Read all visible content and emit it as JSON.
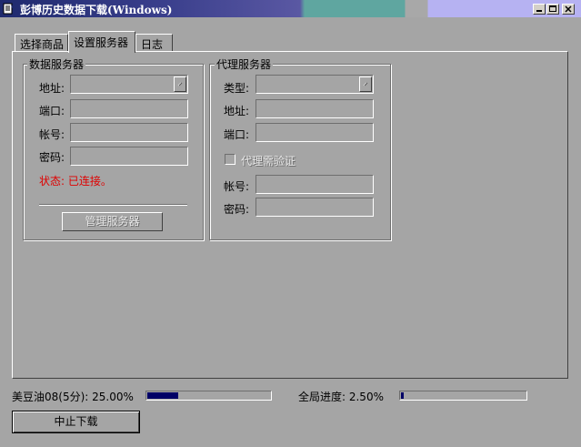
{
  "window": {
    "title": "彭博历史数据下载(Windows)"
  },
  "tabs": [
    {
      "label": "选择商品"
    },
    {
      "label": "设置服务器"
    },
    {
      "label": "日志"
    }
  ],
  "data_server": {
    "title": "数据服务器",
    "address_label": "地址:",
    "address_value": "",
    "port_label": "端口:",
    "port_value": "",
    "account_label": "帐号:",
    "account_value": "",
    "password_label": "密码:",
    "password_value": "",
    "status_text": "状态: 已连接。",
    "manage_button": "管理服务器"
  },
  "proxy_server": {
    "title": "代理服务器",
    "type_label": "类型:",
    "type_value": "",
    "address_label": "地址:",
    "address_value": "",
    "port_label": "端口:",
    "port_value": "",
    "auth_checkbox_label": "代理需验证",
    "auth_checked": false,
    "account_label": "帐号:",
    "account_value": "",
    "password_label": "密码:",
    "password_value": ""
  },
  "progress": {
    "item_label": "美豆油08(5分): 25.00%",
    "item_value": 0.25,
    "overall_label": "全局进度: 2.50%",
    "overall_value": 0.025
  },
  "stop_button": "中止下载",
  "colors": {
    "status_red": "#e00000",
    "progress_fill": "#000066"
  }
}
